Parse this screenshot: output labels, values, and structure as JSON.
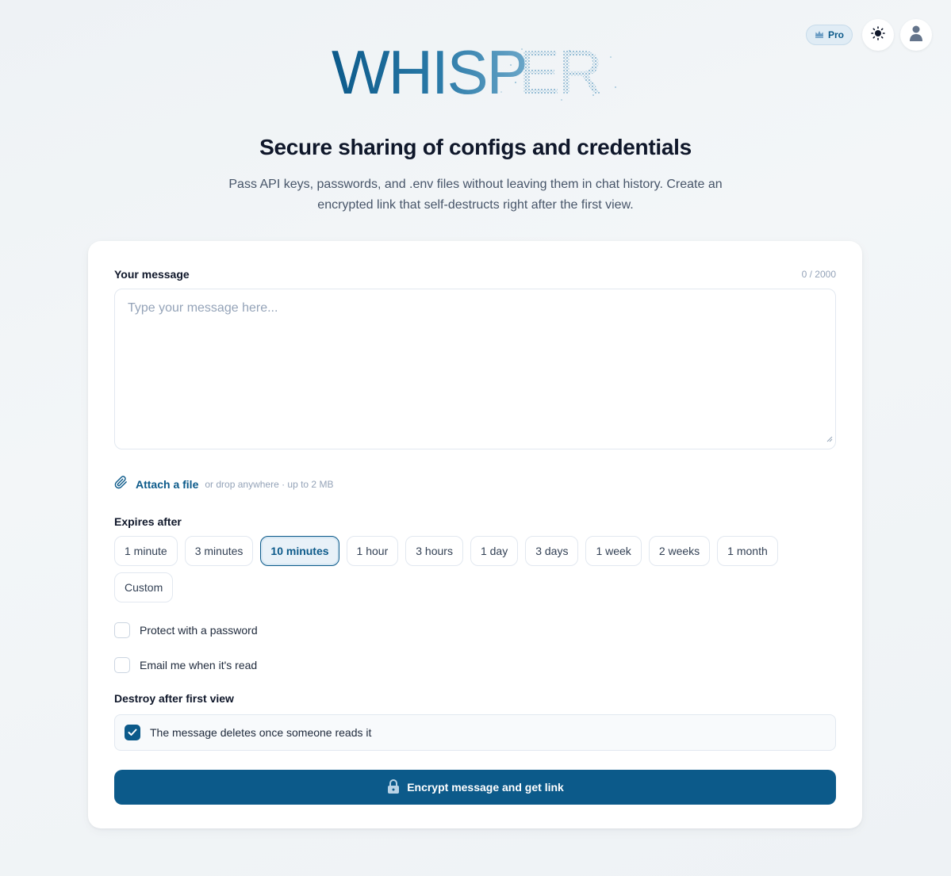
{
  "header": {
    "pro_label": "Pro",
    "logo_text": "WHISPER",
    "icons": [
      "crown-icon",
      "sun-icon",
      "user-icon"
    ]
  },
  "hero": {
    "title": "Secure sharing of configs and credentials",
    "subtitle": "Pass API keys, passwords, and .env files without leaving them in chat history. Create an encrypted link that self-destructs right after the first view."
  },
  "form": {
    "message_label": "Your message",
    "counter": "0 / 2000",
    "message_placeholder": "Type your message here...",
    "attach_label": "Attach a file",
    "attach_hint": "or drop anywhere · up to 2 MB",
    "expires_label": "Expires after",
    "expiry_options": [
      "1 minute",
      "3 minutes",
      "10 minutes",
      "1 hour",
      "3 hours",
      "1 day",
      "3 days",
      "1 week",
      "2 weeks",
      "1 month",
      "Custom"
    ],
    "expiry_selected": "10 minutes",
    "password_label": "Protect with a password",
    "email_label": "Email me when it's read",
    "destroy_heading": "Destroy after first view",
    "destroy_option": "The message deletes once someone reads it",
    "destroy_checked": true,
    "submit_label": "Encrypt message and get link"
  },
  "colors": {
    "accent": "#0c5a8a",
    "text": "#0f172a",
    "muted": "#94a3b8"
  }
}
